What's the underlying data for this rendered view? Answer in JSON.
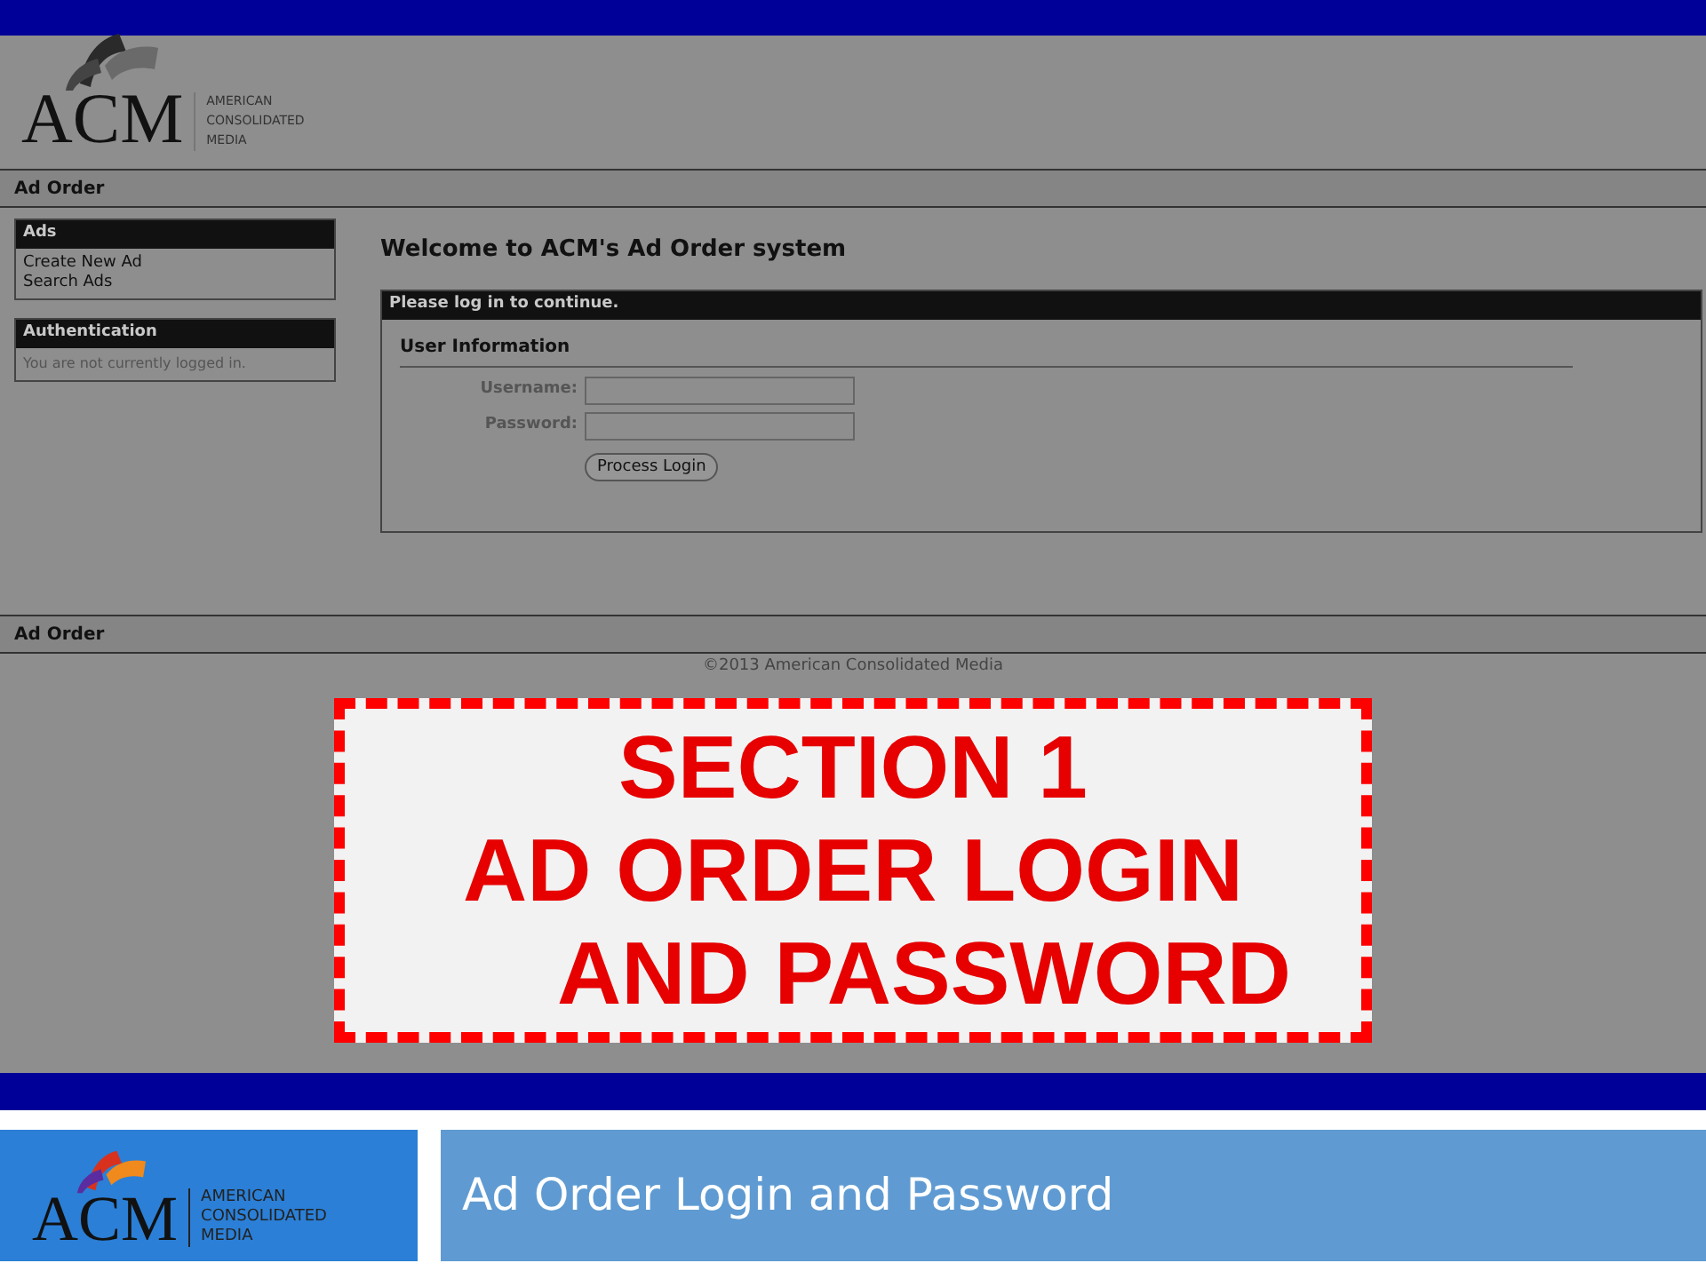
{
  "screen": {
    "header": {
      "logo_mark": "ACM",
      "logo_text": [
        "AMERICAN",
        "CONSOLIDATED",
        "MEDIA"
      ]
    },
    "nav_bar": "Ad Order",
    "sidebar": [
      {
        "title": "Ads",
        "items": [
          "Create New Ad",
          "Search Ads"
        ]
      },
      {
        "title": "Authentication",
        "note": "You are not currently logged in."
      }
    ],
    "welcome": "Welcome to ACM's Ad Order system",
    "login_panel": {
      "header": "Please log in to continue.",
      "section": "User Information",
      "fields": [
        {
          "label": "Username:"
        },
        {
          "label": "Password:"
        }
      ],
      "button": "Process Login"
    },
    "footer_bar": "Ad Order",
    "copyright": "©2013 American Consolidated Media"
  },
  "stamp": {
    "lines": [
      "SECTION 1",
      "AD ORDER LOGIN",
      "AND PASSWORD"
    ]
  },
  "slide_footer": {
    "logo_mark": "ACM",
    "logo_text": [
      "AMERICAN",
      "CONSOLIDATED",
      "MEDIA"
    ],
    "title": "Ad Order Login and Password"
  }
}
